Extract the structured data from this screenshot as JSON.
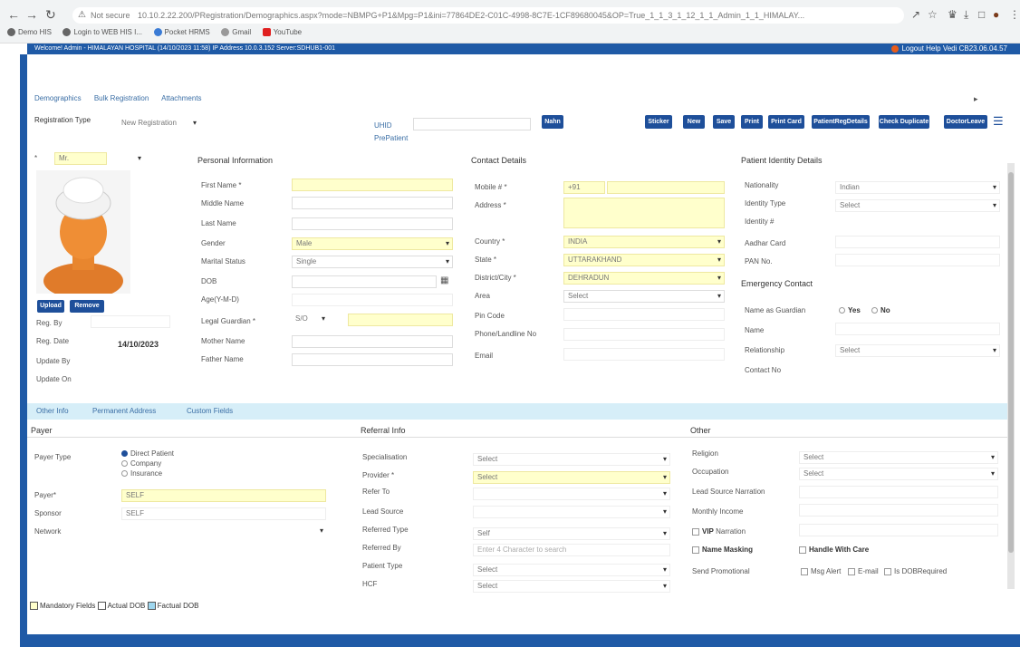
{
  "browser": {
    "url_warning": "Not secure",
    "url": "10.10.2.22.200/PRegistration/Demographics.aspx?mode=NBMPG+P1&Mpg=P1&ini=77864DE2-C01C-4998-8C7E-1CF89680045&OP=True_1_1_3_1_12_1_1_Admin_1_1_HIMALAY...",
    "bookmarks": [
      "Demo HIS",
      "Login to WEB HIS I...",
      "Pocket HRMS",
      "Gmail",
      "YouTube"
    ]
  },
  "appbar": {
    "welcome": "Welcome! Admin - HIMALAYAN HOSPITAL (14/10/2023 11:58)    IP Address 10.0.3.152 Server:SDHUB1-001",
    "right": "Logout Help Vedi CB23.06.04.57"
  },
  "top_tabs": [
    "Demographics",
    "Bulk Registration",
    "Attachments"
  ],
  "registration": {
    "type_label": "Registration Type",
    "type_value": "New Registration",
    "uhid_label": "UHID",
    "prepatient": "PrePatient",
    "nahn_btn": "Nahn"
  },
  "toolbar": [
    "Sticker",
    "New",
    "Save",
    "Print",
    "Print Card",
    "PatientRegDetails",
    "Check Duplicate",
    "DoctorLeave"
  ],
  "title_value": "Mr.",
  "photo_buttons": {
    "upload": "Upload",
    "remove": "Remove"
  },
  "left_meta": {
    "reg_by": "Reg. By",
    "reg_date": "Reg. Date",
    "reg_date_value": "14/10/2023",
    "update_by": "Update By",
    "update_on": "Update On"
  },
  "personal": {
    "header": "Personal Information",
    "first_name": "First Name *",
    "middle_name": "Middle Name",
    "last_name": "Last Name",
    "gender": "Gender",
    "gender_value": "Male",
    "marital": "Marital Status",
    "marital_value": "Single",
    "dob": "DOB",
    "age": "Age(Y-M-D)",
    "legal_guardian": "Legal Guardian *",
    "lg_value": "S/O",
    "mother": "Mother Name",
    "father": "Father Name"
  },
  "contact": {
    "header": "Contact Details",
    "mobile": "Mobile # *",
    "mobile_code": "+91",
    "address": "Address *",
    "country": "Country *",
    "country_value": "INDIA",
    "state": "State *",
    "state_value": "UTTARAKHAND",
    "district": "District/City *",
    "district_value": "DEHRADUN",
    "area": "Area",
    "area_value": "Select",
    "pin": "Pin Code",
    "phone": "Phone/Landline No",
    "email": "Email"
  },
  "identity": {
    "header": "Patient Identity Details",
    "nationality": "Nationality",
    "nationality_value": "Indian",
    "id_type": "Identity Type",
    "id_type_value": "Select",
    "id_no": "Identity #",
    "aadhar": "Aadhar Card",
    "pan": "PAN No.",
    "emergency": "Emergency Contact",
    "name_as_guardian": "Name as Guardian",
    "yes": "Yes",
    "no": "No",
    "name": "Name",
    "relationship": "Relationship",
    "relationship_value": "Select",
    "contact_no": "Contact No"
  },
  "sub_tabs": [
    "Other Info",
    "Permanent Address",
    "Custom Fields"
  ],
  "payer": {
    "header": "Payer",
    "payer_type": "Payer Type",
    "options": [
      "Direct Patient",
      "Company",
      "Insurance"
    ],
    "payer": "Payer*",
    "payer_value": "SELF",
    "sponsor": "Sponsor",
    "sponsor_value": "SELF",
    "network": "Network"
  },
  "referral": {
    "header": "Referral Info",
    "specialisation": "Specialisation",
    "specialisation_value": "Select",
    "provider": "Provider *",
    "provider_value": "Select",
    "refer_to": "Refer To",
    "lead_source": "Lead Source",
    "referred_type": "Referred Type",
    "referred_type_value": "Self",
    "referred_by": "Referred By",
    "referred_by_placeholder": "Enter 4 Character to search",
    "patient_type": "Patient Type",
    "patient_type_value": "Select",
    "hcf": "HCF",
    "hcf_value": "Select"
  },
  "other": {
    "header": "Other",
    "religion": "Religion",
    "religion_value": "Select",
    "occupation": "Occupation",
    "occupation_value": "Select",
    "lead_source_narration": "Lead Source Narration",
    "monthly_income": "Monthly Income",
    "vip": "VIP",
    "narration": "Narration",
    "name_masking": "Name Masking",
    "handle_with_care": "Handle With Care",
    "send_promotional": "Send Promotional",
    "promo_opts": [
      "Msg Alert",
      "E-mail",
      "Is DOBRequired"
    ]
  },
  "legend": [
    "Mandatory Fields",
    "Actual DOB",
    "Factual DOB"
  ],
  "colors": {
    "primary": "#1e4f9a",
    "appbar": "#1f5aa6",
    "mandatory": "#ffffcc",
    "subtabs": "#d6eef8"
  }
}
